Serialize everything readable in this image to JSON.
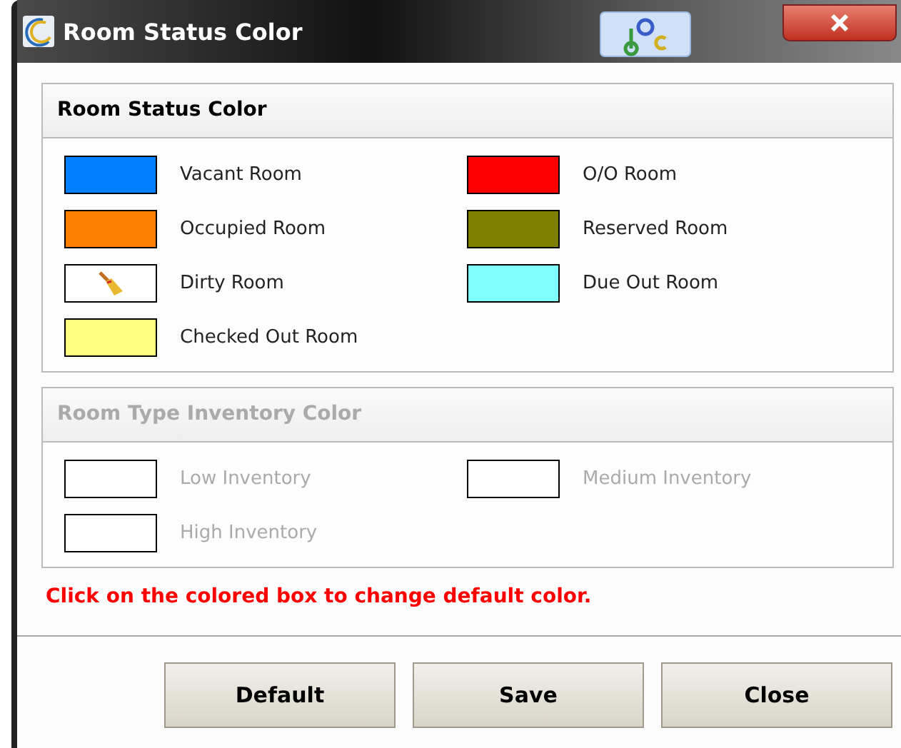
{
  "window": {
    "title": "Room Status Color"
  },
  "sections": [
    {
      "title": "Room Status Color",
      "disabled": false,
      "items": [
        {
          "label": "Vacant Room",
          "kind": "swatch",
          "color": "#0080ff"
        },
        {
          "label": "O/O Room",
          "kind": "swatch",
          "color": "#ff0000"
        },
        {
          "label": "Occupied Room",
          "kind": "swatch",
          "color": "#ff8000"
        },
        {
          "label": "Reserved Room",
          "kind": "swatch",
          "color": "#808000"
        },
        {
          "label": "Dirty Room",
          "kind": "broom"
        },
        {
          "label": "Due Out Room",
          "kind": "swatch",
          "color": "#80ffff"
        },
        {
          "label": "Checked Out Room",
          "kind": "swatch",
          "color": "#ffff80"
        }
      ]
    },
    {
      "title": "Room Type Inventory Color",
      "disabled": true,
      "items": [
        {
          "label": "Low Inventory",
          "kind": "swatch",
          "color": "#ffffff"
        },
        {
          "label": "Medium Inventory",
          "kind": "swatch",
          "color": "#ffffff"
        },
        {
          "label": "High Inventory",
          "kind": "swatch",
          "color": "#ffffff"
        }
      ]
    }
  ],
  "note": "Click on the colored box to change default color.",
  "buttons": [
    "Default",
    "Save",
    "Close"
  ]
}
